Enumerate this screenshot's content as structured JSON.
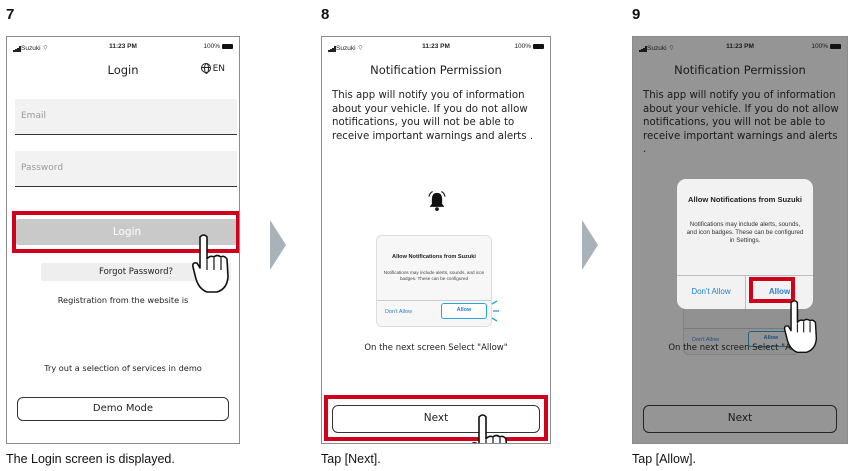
{
  "accent_red": "#d0021b",
  "link_blue": "#2a7fd4",
  "steps": [
    {
      "number": "7",
      "caption": "The Login screen is displayed.",
      "status": {
        "carrier": "Suzuki",
        "time": "11:23 PM",
        "battery": "100%"
      },
      "title": "Login",
      "language": "EN",
      "language_icon": "globe-icon",
      "email_placeholder": "Email",
      "password_placeholder": "Password",
      "login_button": "Login",
      "forgot_password": "Forgot Password?",
      "registration_text": "Registration from the website is",
      "demo_text": "Try out a selection of services in demo",
      "demo_button": "Demo Mode"
    },
    {
      "number": "8",
      "caption": "Tap [Next].",
      "status": {
        "carrier": "Suzuki",
        "time": "11:23 PM",
        "battery": "100%"
      },
      "title": "Notification Permission",
      "body": "This app will notify you of information about your vehicle. If you do not allow notifications, you will not be able to receive important warnings and alerts .",
      "bell_icon": "bell-icon",
      "dialog_title": "Allow Notifications from Suzuki",
      "dialog_body": "Notifications may include alerts, sounds, and icon badges. These can be configured",
      "dont_allow": "Don't Allow",
      "allow": "Allow",
      "instruction": "On the next screen Select \"Allow\"",
      "next_button": "Next"
    },
    {
      "number": "9",
      "caption": "Tap [Allow].",
      "status": {
        "carrier": "Suzuki",
        "time": "11:23 PM",
        "battery": "100%"
      },
      "title": "Notification Permission",
      "body": "This app will notify you of information about your vehicle. If you do not allow notifications, you will not be able to receive important warnings and alerts .",
      "dialog_title": "Allow Notifications from Suzuki",
      "dialog_body": "Notifications may include alerts, sounds, and icon badges. These can be configured in Settings.",
      "dont_allow": "Don't Allow",
      "allow": "Allow",
      "bg_dont_allow": "Don't Allow",
      "bg_allow": "Allow",
      "instruction": "On the next screen Select \"Allow\"",
      "next_button": "Next"
    }
  ]
}
